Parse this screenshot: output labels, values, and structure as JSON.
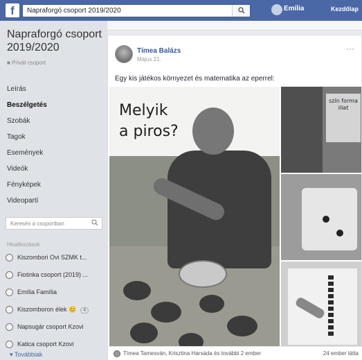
{
  "topbar": {
    "logo": "f",
    "search_value": "Napraforgó csoport 2019/2020",
    "user_name": "Emília",
    "home_label": "Kezdőlap"
  },
  "sidebar": {
    "group_title": "Napraforgó csoport 2019/2020",
    "privacy": "Privát csoport",
    "nav": [
      "Leírás",
      "Beszélgetés",
      "Szobák",
      "Tagok",
      "Események",
      "Videók",
      "Fényképek",
      "Videopartí"
    ],
    "active_index": 1,
    "search_placeholder": "Keresés a csoportban",
    "shortcuts_label": "Hivatkozások",
    "shortcuts": [
      {
        "label": "Kiszombori Ovi SZMK t...",
        "count": ""
      },
      {
        "label": "Fiośnka csoport (2019) ...",
        "count": ""
      },
      {
        "label": "Emília Família",
        "count": ""
      },
      {
        "label": "Kiszomboron élek 😊",
        "count": "4"
      },
      {
        "label": "Napsugár csoport Kzovi",
        "count": ""
      },
      {
        "label": "Katica csoport Kzovi",
        "count": ""
      }
    ],
    "more_label": "▾ Továbbiak"
  },
  "post": {
    "author": "Tímea Balázs",
    "timestamp": "Május 21.",
    "more": "···",
    "text": "Egy kis játékos környezet és matematika az eperrel:",
    "caption_line1": "Melyik",
    "caption_line2": "a piros?",
    "photo_label": "szín forma illat",
    "reactions_text": "Tímea Tamesván, Krisztina Harsáda és további 2 ember",
    "seen_text": "24 ember látta"
  },
  "colors": {
    "topbar": "#4a67a6",
    "link": "#365899",
    "sidebar_bg": "#dfe2e7",
    "page_bg": "#e9ebee"
  }
}
